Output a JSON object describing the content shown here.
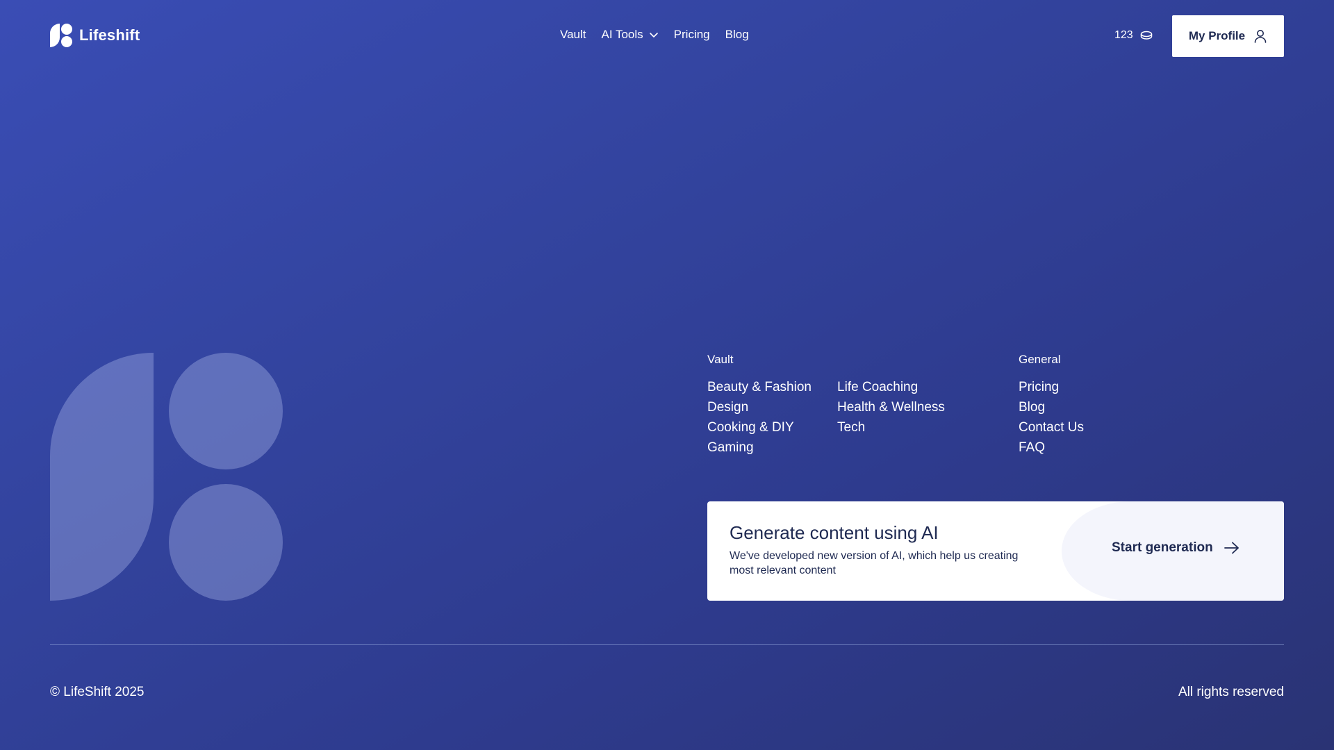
{
  "header": {
    "brand": "Lifeshift",
    "nav": {
      "vault": "Vault",
      "ai_tools": "AI Tools",
      "pricing": "Pricing",
      "blog": "Blog"
    },
    "credits": "123",
    "profile_label": "My Profile"
  },
  "footer": {
    "vault": {
      "title": "Vault",
      "col1": [
        "Beauty & Fashion",
        "Design",
        "Cooking & DIY",
        "Gaming"
      ],
      "col2": [
        "Life Coaching",
        "Health & Wellness",
        "Tech"
      ]
    },
    "general": {
      "title": "General",
      "links": [
        "Pricing",
        "Blog",
        "Contact Us",
        "FAQ"
      ]
    },
    "cta": {
      "title": "Generate content using AI",
      "description": "We've developed new version of AI, which help us creating most relevant content",
      "button": "Start generation"
    },
    "copyright": "© LifeShift 2025",
    "rights": "All rights reserved"
  },
  "colors": {
    "background_start": "#3a4db5",
    "background_end": "#2a3374",
    "card": "#ffffff",
    "card_accent": "#f4f5fc",
    "text_dark": "#1f2a52"
  },
  "icons": {
    "logo": "lifeshift-logo-icon",
    "dropdown": "chevron-down-icon",
    "credits": "coin-icon",
    "profile": "user-icon",
    "cta": "arrow-right-icon"
  }
}
